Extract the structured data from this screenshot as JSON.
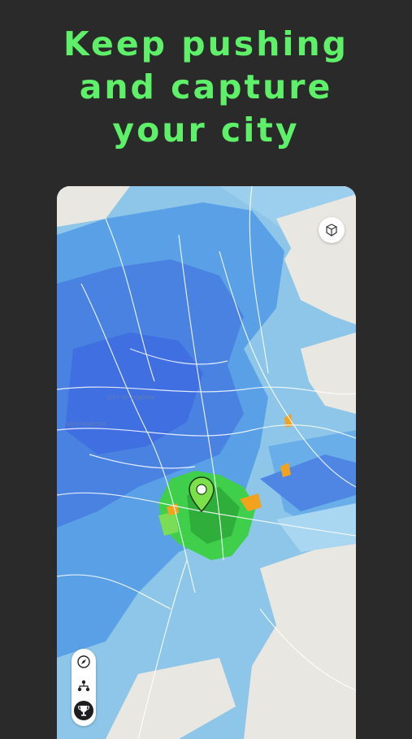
{
  "headline": {
    "line1": "Keep pushing",
    "line2": "and capture",
    "line3": "your city"
  },
  "map": {
    "labels": [
      "CITY OF LONDON",
      "WESTMINSTER"
    ],
    "colors": {
      "base": "#e9e7e2",
      "light_blue": "#8dc6e8",
      "mid_blue": "#5aa0e6",
      "dark_blue": "#3f6fe0",
      "green": "#3fcf4a",
      "orange": "#f2a21c"
    }
  },
  "controls": {
    "view_3d_icon": "cube-icon",
    "compass_icon": "compass-icon",
    "team_icon": "hierarchy-icon",
    "trophy_icon": "trophy-icon"
  },
  "pin": {
    "icon": "location-pin-icon",
    "color": "#7be04a"
  }
}
